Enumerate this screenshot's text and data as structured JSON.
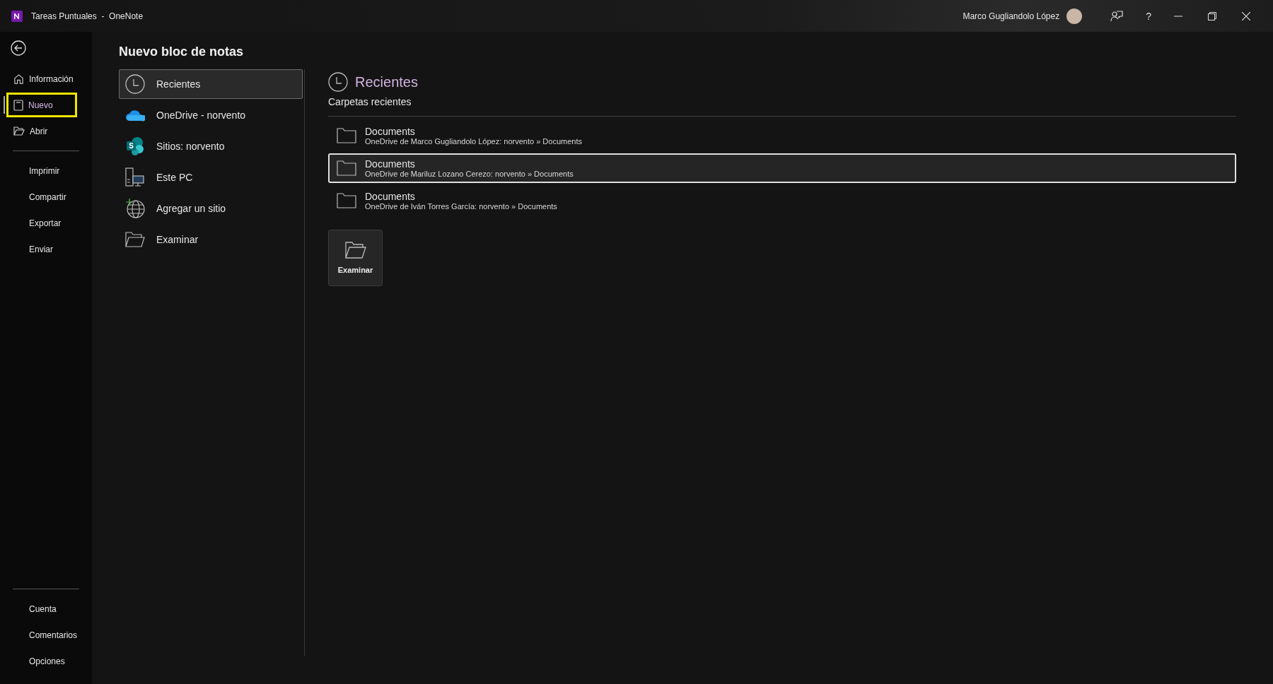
{
  "window": {
    "title": "Tareas Puntuales  -  OneNote",
    "user": "Marco Gugliandolo López",
    "help": "?"
  },
  "sidebar": {
    "primary": [
      {
        "label": "Información",
        "kind": "home",
        "selected": false,
        "highlighted": false
      },
      {
        "label": "Nuevo",
        "kind": "notebook",
        "selected": true,
        "highlighted": true
      },
      {
        "label": "Abrir",
        "kind": "folder",
        "selected": false,
        "highlighted": false
      }
    ],
    "secondary": [
      {
        "label": "Imprimir",
        "selected": false
      },
      {
        "label": "Compartir",
        "selected": false
      },
      {
        "label": "Exportar",
        "selected": false
      },
      {
        "label": "Enviar",
        "selected": false
      }
    ],
    "footer": [
      {
        "label": "Cuenta",
        "selected": false
      },
      {
        "label": "Comentarios",
        "selected": false
      },
      {
        "label": "Opciones",
        "selected": false
      }
    ]
  },
  "heading": "Nuevo bloc de notas",
  "locations": [
    {
      "label": "Recientes",
      "kind": "clock",
      "selected": true
    },
    {
      "label": "OneDrive - norvento",
      "kind": "cloud",
      "selected": false
    },
    {
      "label": "Sitios: norvento",
      "kind": "sites",
      "logo_letter": "S",
      "selected": false
    },
    {
      "label": "Este PC",
      "kind": "pc",
      "selected": false
    },
    {
      "label": "Agregar un sitio",
      "kind": "globe",
      "selected": false
    },
    {
      "label": "Examinar",
      "kind": "folder",
      "selected": false
    }
  ],
  "recent": {
    "title": "Recientes",
    "subtitle": "Carpetas recientes",
    "folders": [
      {
        "name": "Documents",
        "path": "OneDrive de Marco Gugliandolo López: norvento » Documents",
        "selected": false
      },
      {
        "name": "Documents",
        "path": "OneDrive de Mariluz Lozano Cerezo: norvento » Documents",
        "selected": true
      },
      {
        "name": "Documents",
        "path": "OneDrive de Iván Torres García: norvento » Documents",
        "selected": false
      }
    ],
    "browse": "Examinar"
  }
}
